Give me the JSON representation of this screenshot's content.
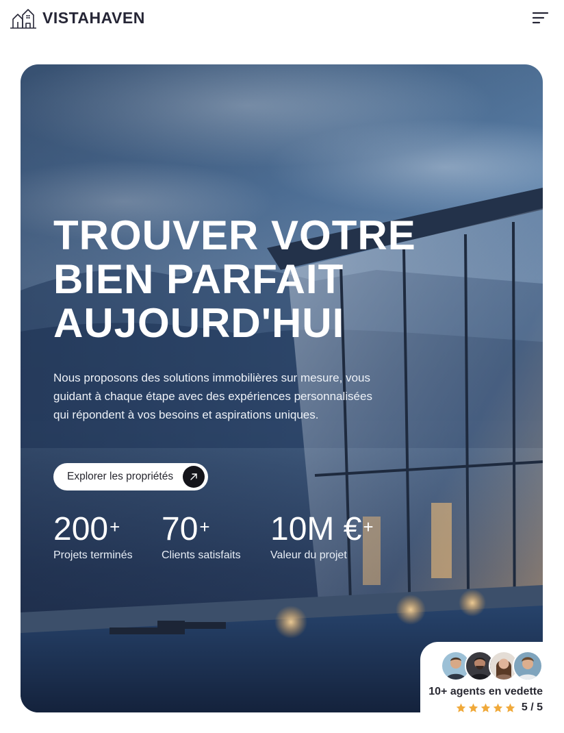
{
  "brand": {
    "name": "VISTAHAVEN",
    "logo_icon": "house-logo-icon"
  },
  "header": {
    "menu_icon": "menu-icon"
  },
  "hero": {
    "title_lines": [
      "TROUVER VOTRE",
      "BIEN PARFAIT",
      "AUJOURD'HUI"
    ],
    "description": "Nous proposons des solutions immobilières sur mesure, vous guidant à chaque étape avec des expériences personnalisées qui répondent à vos besoins et aspirations uniques.",
    "cta": {
      "label": "Explorer les propriétés",
      "icon": "arrow-up-right-icon"
    }
  },
  "stats": [
    {
      "value": "200",
      "suffix": "+",
      "label": "Projets terminés"
    },
    {
      "value": "70",
      "suffix": "+",
      "label": "Clients satisfaits"
    },
    {
      "value": "10M €",
      "suffix": "+",
      "label": "Valeur du projet"
    }
  ],
  "agents": {
    "text": "10+ agents en vedette",
    "rating": "5 / 5",
    "stars": 5,
    "star_color": "#f0a93a"
  },
  "colors": {
    "accent_dark": "#14141a",
    "text_dark": "#262636"
  }
}
